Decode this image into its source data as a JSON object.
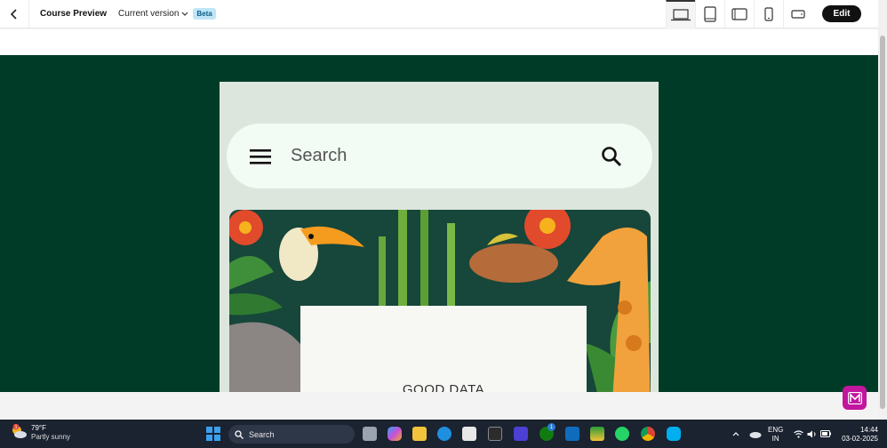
{
  "header": {
    "title": "Course Preview",
    "version_label": "Current version",
    "beta_badge": "Beta",
    "edit_label": "Edit",
    "devices": [
      "laptop-icon",
      "tablet-portrait-icon",
      "tablet-landscape-icon",
      "phone-portrait-icon",
      "phone-landscape-icon"
    ]
  },
  "preview": {
    "search_placeholder": "Search",
    "card_text": "GOOD DATA"
  },
  "taskbar": {
    "weather_temp": "79°F",
    "weather_desc": "Partly sunny",
    "weather_badge": "1",
    "search_label": "Search",
    "xbox_badge": "1",
    "language": "ENG",
    "region": "IN",
    "time": "14:44",
    "date": "03-02-2025"
  },
  "colors": {
    "stage": "#003b28",
    "fab": "#c3169f",
    "taskbar": "#1b2230"
  }
}
